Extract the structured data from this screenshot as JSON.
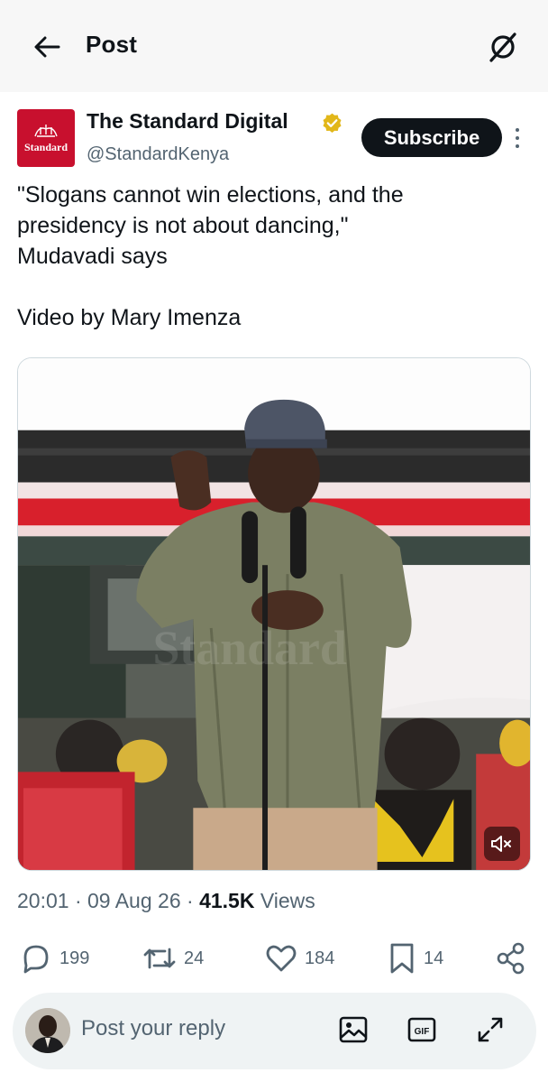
{
  "header": {
    "title": "Post",
    "back_icon": "arrow-left-icon",
    "grok_icon": "grok-icon"
  },
  "author": {
    "name": "The Standard Digital",
    "handle": "@StandardKenya",
    "verified": true,
    "verified_color": "#e2b719",
    "logo_text": "Standard",
    "logo_color": "#c8102e"
  },
  "subscribe_label": "Subscribe",
  "tweet": {
    "lines": [
      "\"Slogans cannot win elections, and the",
      "presidency is not about dancing,\"",
      "Mudavadi says"
    ],
    "credit": "Video by Mary Imenza"
  },
  "media": {
    "type": "video",
    "muted": true,
    "watermark": "Standard"
  },
  "meta": {
    "time": "20:01",
    "date": "09 Aug 26",
    "views_count": "41.5K",
    "views_label": "Views",
    "separator": "·"
  },
  "actions": {
    "replies": "199",
    "reposts": "24",
    "likes": "184",
    "bookmarks": "14"
  },
  "reply": {
    "placeholder": "Post your reply"
  },
  "colors": {
    "text": "#0f1419",
    "secondary": "#536471",
    "reply_bg": "#eff3f4",
    "border": "#cfd9de"
  }
}
